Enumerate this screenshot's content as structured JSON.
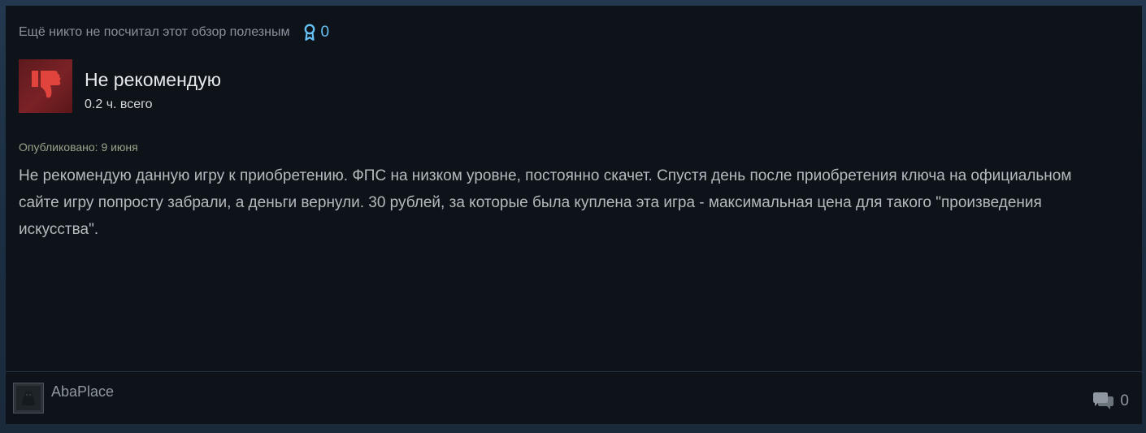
{
  "review": {
    "helpful_text": "Ещё никто не посчитал этот обзор полезным",
    "awards_count": "0",
    "verdict": "Не рекомендую",
    "hours": "0.2 ч. всего",
    "posted": "Опубликовано: 9 июня",
    "text": "Не рекомендую данную игру к приобретению. ФПС на низком уровне, постоянно скачет. Спустя день после приобретения ключа на официальном сайте игру попросту забрали, а деньги вернули. 30 рублей, за которые была куплена эта игра - максимальная цена для такого \"произведения искусства\"."
  },
  "footer": {
    "author": "AbaPlace",
    "comments_count": "0"
  },
  "icons": {
    "award": "award-ribbon-icon",
    "vote": "thumbs-down-icon",
    "comments": "comment-bubbles-icon"
  },
  "colors": {
    "accent": "#66c0f4",
    "negative": "#e0443c",
    "card_background": "#0e131a"
  }
}
